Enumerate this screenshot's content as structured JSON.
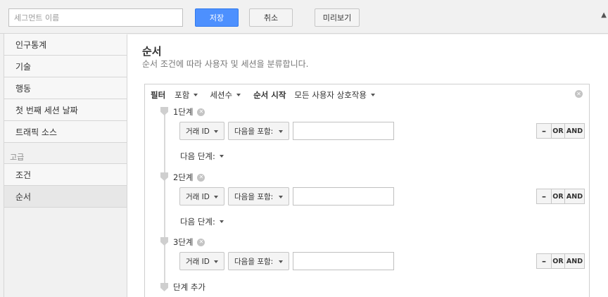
{
  "header": {
    "segment_name_placeholder": "세그먼트 이름",
    "save_label": "저장",
    "cancel_label": "취소",
    "preview_label": "미리보기",
    "collapse_icon": "chevron-up-icon"
  },
  "sidebar": {
    "items": [
      {
        "label": "인구통계"
      },
      {
        "label": "기술"
      },
      {
        "label": "행동"
      },
      {
        "label": "첫 번째 세션 날짜"
      },
      {
        "label": "트래픽 소스"
      }
    ],
    "advanced_heading": "고급",
    "advanced_items": [
      {
        "label": "조건"
      },
      {
        "label": "순서",
        "active": true
      }
    ]
  },
  "main": {
    "title": "순서",
    "description": "순서 조건에 따라 사용자 및 세션을 분류합니다.",
    "filter": {
      "label": "필터",
      "include": "포함",
      "scope": "세션수",
      "sequence_start_label": "순서 시작",
      "sequence_start_value": "모든 사용자 상호작용"
    },
    "steps": [
      {
        "label": "1단계",
        "dimension": "거래 ID",
        "match": "다음을 포함:",
        "value": "",
        "next": "다음 단계:"
      },
      {
        "label": "2단계",
        "dimension": "거래 ID",
        "match": "다음을 포함:",
        "value": "",
        "next": "다음 단계:"
      },
      {
        "label": "3단계",
        "dimension": "거래 ID",
        "match": "다음을 포함:",
        "value": ""
      }
    ],
    "ops": {
      "minus": "–",
      "or": "OR",
      "and": "AND"
    },
    "add_step": "단계 추가"
  },
  "colors": {
    "save_button": "#4d90fe",
    "background": "#f1f1f1",
    "active_item": "#e7e7e7"
  }
}
